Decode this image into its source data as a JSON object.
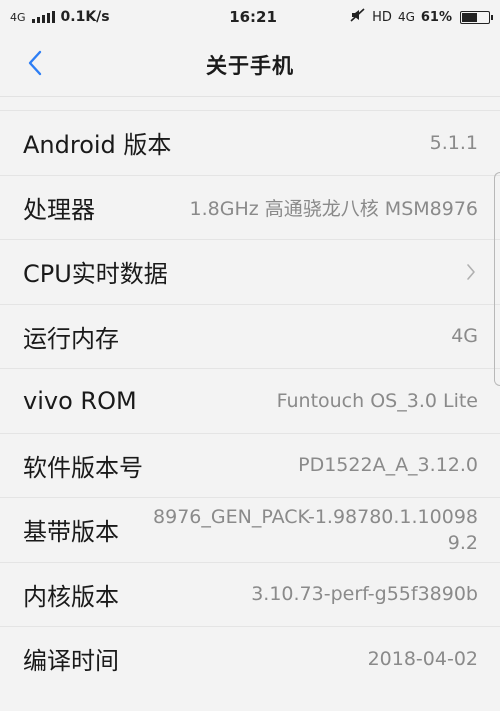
{
  "status_bar": {
    "network_type": "4G",
    "data_speed": "0.1K/s",
    "time": "16:21",
    "hd_label": "HD",
    "network_type_right": "4G",
    "battery_percent": "61%",
    "battery_level": 0.61
  },
  "header": {
    "title": "关于手机",
    "back_icon": "chevron-left-icon",
    "accent_color": "#2d7ef5"
  },
  "rows": [
    {
      "label": "Android 版本",
      "value": "5.1.1"
    },
    {
      "label": "处理器",
      "value": "1.8GHz 高通骁龙八核 MSM8976"
    },
    {
      "label": "CPU实时数据",
      "value": ""
    },
    {
      "label": "运行内存",
      "value": "4G"
    },
    {
      "label": "vivo ROM",
      "value": "Funtouch OS_3.0 Lite"
    },
    {
      "label": "软件版本号",
      "value": "PD1522A_A_3.12.0"
    },
    {
      "label": "基带版本",
      "value": "8976_GEN_PACK-1.98780.1.100989.2"
    },
    {
      "label": "内核版本",
      "value": "3.10.73-perf-g55f3890b"
    },
    {
      "label": "编译时间",
      "value": "2018-04-02"
    }
  ]
}
